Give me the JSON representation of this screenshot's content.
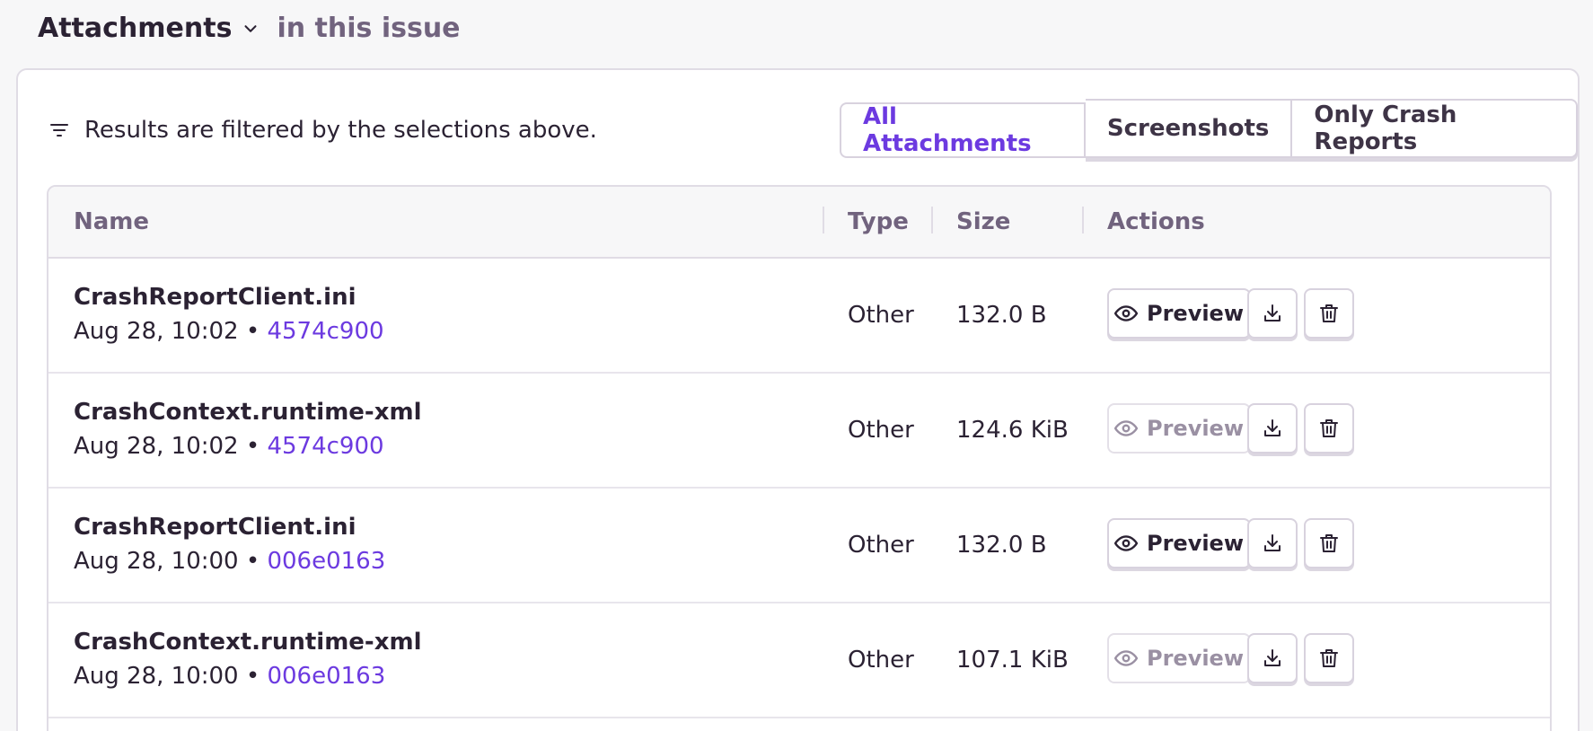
{
  "header": {
    "title": "Attachments",
    "subtitle": "in this issue"
  },
  "filter_note": "Results are filtered by the selections above.",
  "tabs": [
    {
      "label": "All Attachments",
      "active": true
    },
    {
      "label": "Screenshots",
      "active": false
    },
    {
      "label": "Only Crash Reports",
      "active": false
    }
  ],
  "columns": {
    "name": "Name",
    "type": "Type",
    "size": "Size",
    "actions": "Actions"
  },
  "rows": [
    {
      "name": "CrashReportClient.ini",
      "date": "Aug 28, 10:02 • ",
      "hash": "4574c900",
      "type": "Other",
      "size": "132.0 B",
      "preview_enabled": true
    },
    {
      "name": "CrashContext.runtime-xml",
      "date": "Aug 28, 10:02 • ",
      "hash": "4574c900",
      "type": "Other",
      "size": "124.6 KiB",
      "preview_enabled": false
    },
    {
      "name": "CrashReportClient.ini",
      "date": "Aug 28, 10:00 • ",
      "hash": "006e0163",
      "type": "Other",
      "size": "132.0 B",
      "preview_enabled": true
    },
    {
      "name": "CrashContext.runtime-xml",
      "date": "Aug 28, 10:00 • ",
      "hash": "006e0163",
      "type": "Other",
      "size": "107.1 KiB",
      "preview_enabled": false
    }
  ],
  "actions": {
    "preview_label": "Preview"
  },
  "colors": {
    "accent": "#6c3ae0",
    "text": "#2b2233",
    "muted": "#71637e"
  },
  "icons": {
    "filter": "filter-icon",
    "chevron": "chevron-down-icon",
    "preview": "eye-icon",
    "download": "download-icon",
    "delete": "trash-icon"
  }
}
